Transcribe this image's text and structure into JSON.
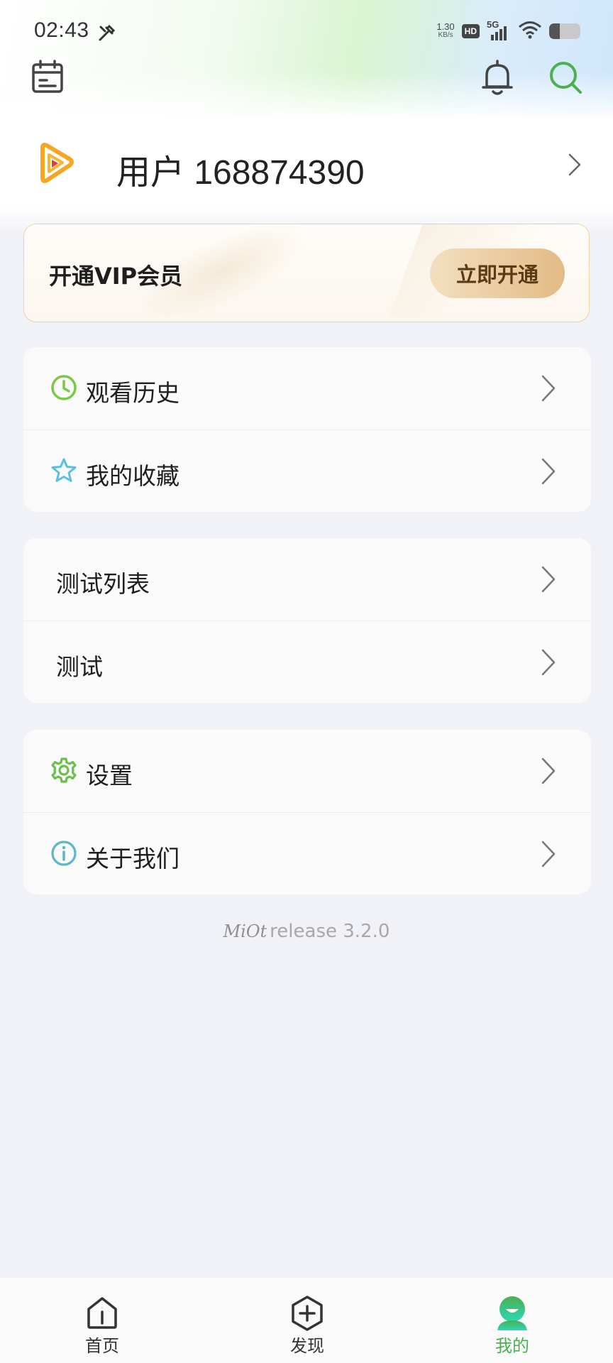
{
  "status_bar": {
    "time": "02:43",
    "net_speed_value": "1.30",
    "net_speed_unit": "KB/s",
    "hd_label": "HD",
    "network_label": "5G",
    "battery_level": 0.35
  },
  "header": {
    "left_icon": "calendar-icon",
    "right_icons": [
      "bell-icon",
      "search-icon"
    ],
    "accent_color": "#4caf50"
  },
  "profile": {
    "username": "用户 168874390"
  },
  "vip": {
    "title": "开通VIP会员",
    "button_label": "立即开通"
  },
  "menu_groups": [
    {
      "items": [
        {
          "label": "观看历史",
          "icon": "clock-icon",
          "icon_color": "#7ac943"
        },
        {
          "label": "我的收藏",
          "icon": "star-icon",
          "icon_color": "#5bc0de"
        }
      ]
    },
    {
      "items": [
        {
          "label": "测试列表"
        },
        {
          "label": "测试"
        }
      ]
    },
    {
      "items": [
        {
          "label": "设置",
          "icon": "gear-icon",
          "icon_color": "#6cc04a"
        },
        {
          "label": "关于我们",
          "icon": "info-icon",
          "icon_color": "#5bb8c4"
        }
      ]
    }
  ],
  "version": {
    "brand": "MiOt",
    "text": "release 3.2.0"
  },
  "bottom_nav": {
    "items": [
      {
        "label": "首页",
        "icon": "home-icon",
        "active": false
      },
      {
        "label": "发现",
        "icon": "discover-plus-icon",
        "active": false
      },
      {
        "label": "我的",
        "icon": "profile-icon",
        "active": true
      }
    ],
    "active_color": "#4caf50"
  }
}
